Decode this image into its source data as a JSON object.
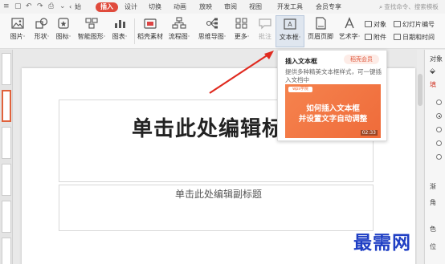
{
  "menubar": {
    "nav_back": "‹",
    "nav_item": "始",
    "tabs": [
      "插入",
      "设计",
      "切换",
      "动画",
      "放映",
      "审阅",
      "视图",
      "开发工具",
      "会员专享"
    ],
    "active_tab": "插入",
    "search_placeholder": "查找命令、搜索模板"
  },
  "ribbon": {
    "buttons": [
      {
        "label": "图片·",
        "icon": "picture-icon"
      },
      {
        "label": "形状·",
        "icon": "shape-icon"
      },
      {
        "label": "图标·",
        "icon": "icon-library-icon"
      },
      {
        "label": "智能图形·",
        "icon": "smartart-icon"
      },
      {
        "label": "图表·",
        "icon": "chart-icon"
      },
      {
        "label": "稻壳素材",
        "icon": "material-icon"
      },
      {
        "label": "流程图·",
        "icon": "flowchart-icon"
      },
      {
        "label": "思维导图·",
        "icon": "mindmap-icon"
      },
      {
        "label": "更多·",
        "icon": "more-icon"
      },
      {
        "label": "批注",
        "icon": "comment-icon"
      },
      {
        "label": "文本框·",
        "icon": "textbox-icon"
      },
      {
        "label": "页眉页脚",
        "icon": "header-footer-icon"
      },
      {
        "label": "艺术字·",
        "icon": "wordart-icon"
      }
    ],
    "small": [
      {
        "label": "对象",
        "icon": "object-icon"
      },
      {
        "label": "附件",
        "icon": "attachment-icon"
      },
      {
        "label": "幻灯片编号",
        "icon": "slide-number-icon"
      },
      {
        "label": "日期和时间",
        "icon": "datetime-icon"
      }
    ]
  },
  "tooltip": {
    "title": "插入文本框",
    "badge": "稻壳会员",
    "description": "提供多种精美文本框样式，可一键插入文档中",
    "video_logo": "wps学院",
    "video_line1": "如何插入文本框",
    "video_line2": "并设置文字自动调整",
    "video_duration": "02:33"
  },
  "slide": {
    "title": "单击此处编辑标题",
    "subtitle": "单击此处编辑副标题"
  },
  "right_panel": {
    "header": "对象",
    "fill_label": "填",
    "gradient_label": "渐",
    "angle_label": "角",
    "color_label": "色",
    "position_label": "位"
  },
  "watermark": "最需网",
  "colors": {
    "accent": "#e04a3c",
    "video_bg": "#f26f3e",
    "watermark": "#1f3fc4"
  }
}
